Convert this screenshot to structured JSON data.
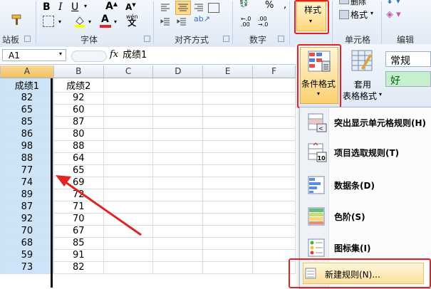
{
  "ribbon": {
    "groups": {
      "clipboard_partial": "站板",
      "font": "字体",
      "alignment": "对齐方式",
      "number": "数字",
      "cells": "单元格",
      "editing": "编辑"
    },
    "styles_label": "样式",
    "delete_label": "删除",
    "format_label": "格式"
  },
  "style_panel": {
    "conditional_format": "条件格式",
    "table_format_line1": "套用",
    "table_format_line2": "表格格式",
    "style_normal": "常规",
    "style_good": "好"
  },
  "formula_bar": {
    "name_box": "A1",
    "fx": "fx",
    "value": "成绩1"
  },
  "grid": {
    "columns": [
      "A",
      "B",
      "C",
      "D",
      "E",
      "F"
    ],
    "rows": [
      [
        "成绩1",
        "成绩2"
      ],
      [
        "82",
        "92"
      ],
      [
        "65",
        "60"
      ],
      [
        "85",
        "87"
      ],
      [
        "86",
        "80"
      ],
      [
        "98",
        "88"
      ],
      [
        "88",
        "64"
      ],
      [
        "77",
        "65"
      ],
      [
        "74",
        "69"
      ],
      [
        "89",
        "72"
      ],
      [
        "87",
        "71"
      ],
      [
        "92",
        "70"
      ],
      [
        "70",
        "67"
      ],
      [
        "68",
        "85"
      ],
      [
        "59",
        "91"
      ],
      [
        "73",
        "82"
      ]
    ]
  },
  "menu": {
    "items": [
      {
        "label": "突出显示单元格规则(H)",
        "icon": "highlight-rules-icon"
      },
      {
        "label": "项目选取规则(T)",
        "icon": "top-bottom-rules-icon"
      },
      {
        "label": "数据条(D)",
        "icon": "data-bars-icon"
      },
      {
        "label": "色阶(S)",
        "icon": "color-scales-icon"
      },
      {
        "label": "图标集(I)",
        "icon": "icon-sets-icon"
      },
      {
        "label": "新建规则(N)...",
        "icon": "new-rule-icon"
      }
    ]
  },
  "colors": {
    "annotation": "#e02424",
    "selection": "#cde3f7",
    "good_style": "#c6efce"
  }
}
